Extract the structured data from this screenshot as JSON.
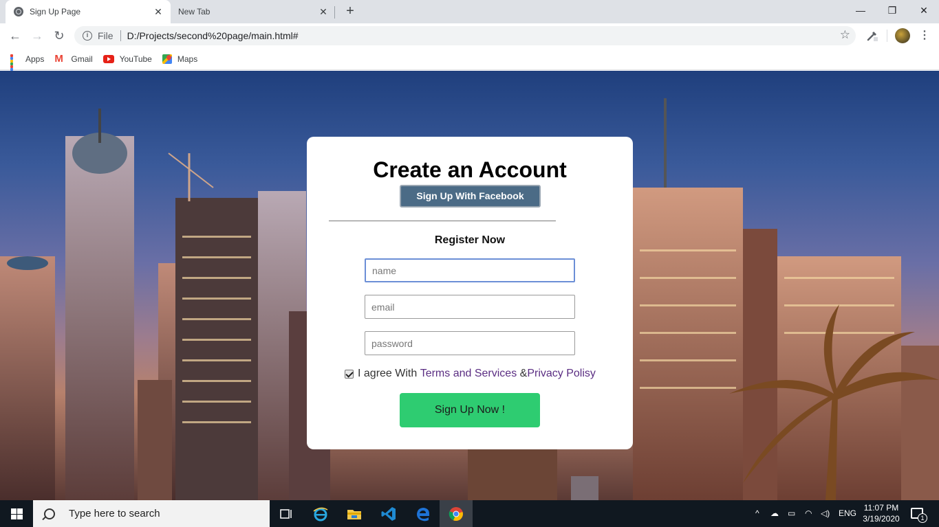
{
  "browser": {
    "tabs": [
      {
        "title": "Sign Up Page",
        "active": true
      },
      {
        "title": "New Tab",
        "active": false
      }
    ],
    "url_scheme": "File",
    "url": "D:/Projects/second%20page/main.html#",
    "bookmarks": [
      {
        "label": "Apps",
        "icon": "apps-grid-icon"
      },
      {
        "label": "Gmail",
        "icon": "gmail-icon"
      },
      {
        "label": "YouTube",
        "icon": "youtube-icon"
      },
      {
        "label": "Maps",
        "icon": "maps-icon"
      }
    ]
  },
  "form": {
    "title": "Create an Account",
    "facebook_button": "Sign Up With Facebook",
    "subtitle": "Register Now",
    "name_placeholder": "name",
    "email_placeholder": "email",
    "password_placeholder": "password",
    "agree_checked": true,
    "agree_text": "I agree With ",
    "terms_link": "Terms and Services",
    "amp": " &",
    "privacy_link": "Privacy Polisy",
    "submit_button": "Sign Up Now !"
  },
  "taskbar": {
    "search_placeholder": "Type here to search",
    "language": "ENG",
    "time": "11:07 PM",
    "date": "3/19/2020",
    "notification_count": "1"
  },
  "colors": {
    "facebook_button": "#4b6b86",
    "submit_button": "#2ecc71",
    "link": "#5a2d82"
  }
}
